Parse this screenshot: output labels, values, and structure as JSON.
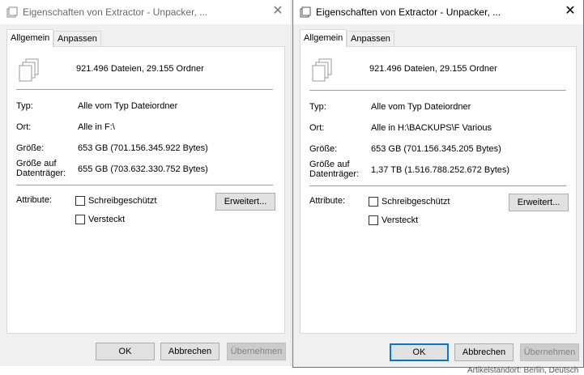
{
  "dialogs": [
    {
      "title": "Eigenschaften von Extractor - Unpacker, ...",
      "tabs": {
        "general": "Allgemein",
        "customize": "Anpassen"
      },
      "summary": "921.496 Dateien, 29.155 Ordner",
      "type_label": "Typ:",
      "type_value": "Alle vom Typ Dateiordner",
      "location_label": "Ort:",
      "location_value": "Alle in F:\\",
      "size_label": "Größe:",
      "size_value": "653 GB (701.156.345.922 Bytes)",
      "disk_size_label_1": "Größe auf",
      "disk_size_label_2": "Datenträger:",
      "disk_size_value": "655 GB (703.632.330.752 Bytes)",
      "attributes_label": "Attribute:",
      "readonly_label": "Schreibgeschützt",
      "hidden_label": "Versteckt",
      "advanced_button": "Erweitert...",
      "ok_button": "OK",
      "cancel_button": "Abbrechen",
      "apply_button": "Übernehmen"
    },
    {
      "title": "Eigenschaften von Extractor - Unpacker, ...",
      "tabs": {
        "general": "Allgemein",
        "customize": "Anpassen"
      },
      "summary": "921.496 Dateien, 29.155 Ordner",
      "type_label": "Typ:",
      "type_value": "Alle vom Typ Dateiordner",
      "location_label": "Ort:",
      "location_value": "Alle in H:\\BACKUPS\\F Various",
      "size_label": "Größe:",
      "size_value": "653 GB (701.156.345.205 Bytes)",
      "disk_size_label_1": "Größe auf",
      "disk_size_label_2": "Datenträger:",
      "disk_size_value": "1,37 TB (1.516.788.252.672 Bytes)",
      "attributes_label": "Attribute:",
      "readonly_label": "Schreibgeschützt",
      "hidden_label": "Versteckt",
      "advanced_button": "Erweitert...",
      "ok_button": "OK",
      "cancel_button": "Abbrechen",
      "apply_button": "Übernehmen"
    }
  ],
  "background_text": "Artikelstandort: Berlin, Deutsch"
}
